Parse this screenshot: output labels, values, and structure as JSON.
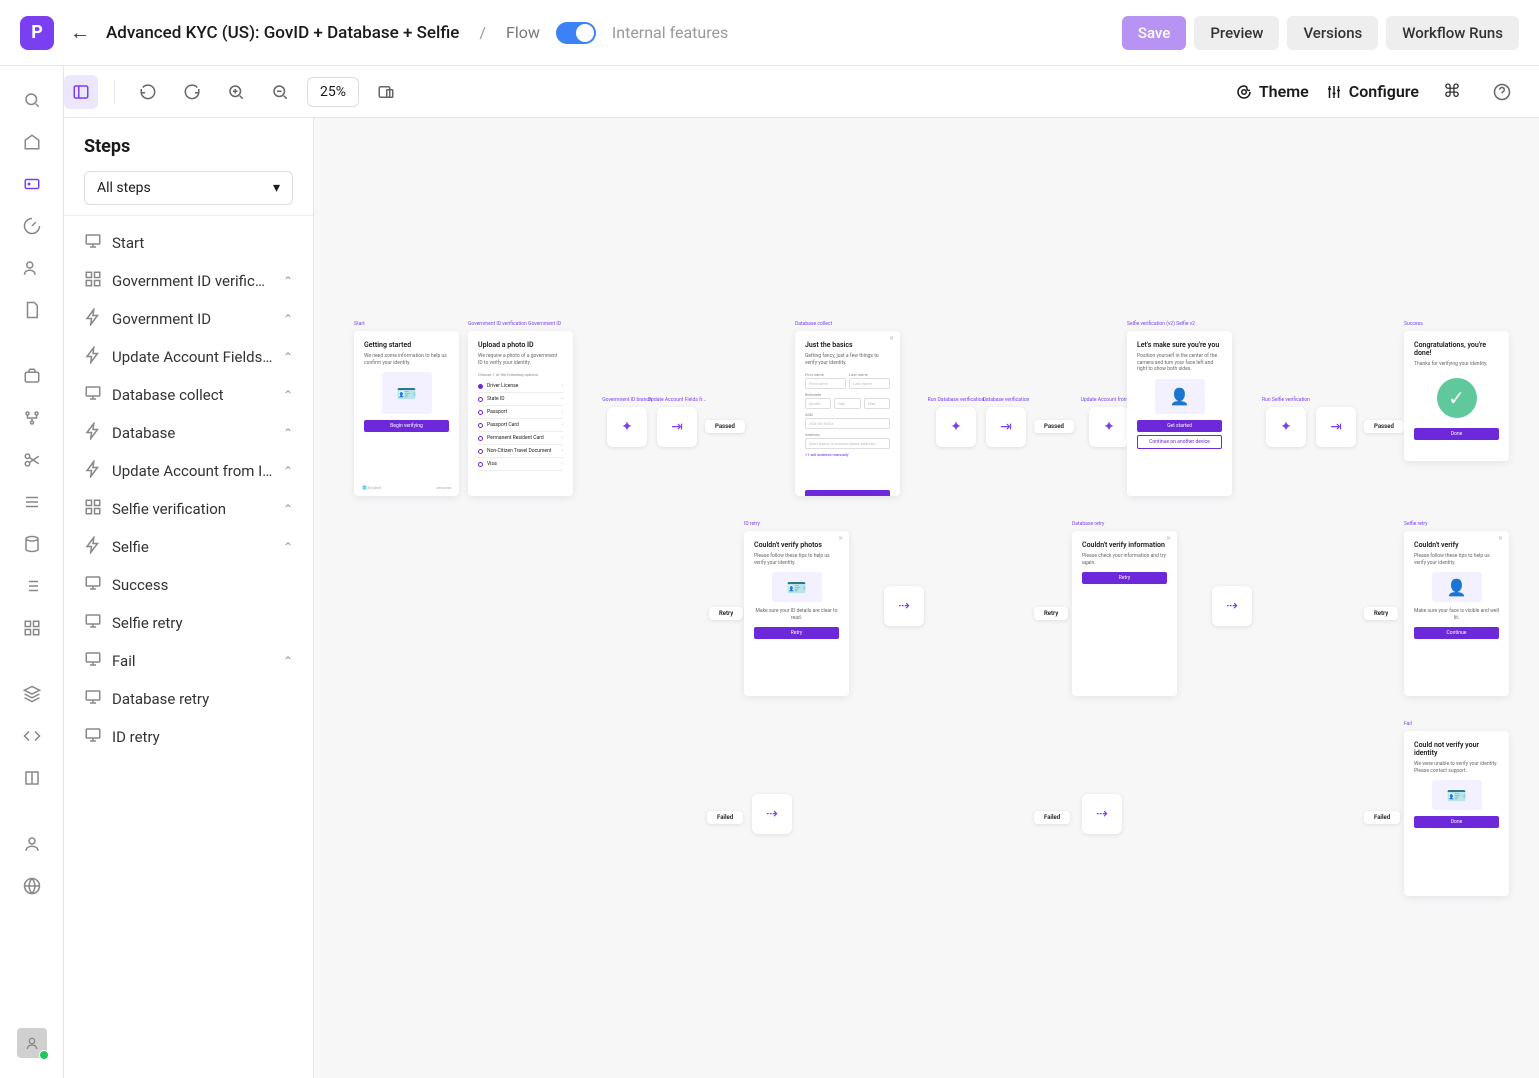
{
  "header": {
    "title": "Advanced KYC (US): GovID + Database + Selfie",
    "breadcrumb_slash": "/",
    "flow_label": "Flow",
    "internal_features": "Internal features",
    "save": "Save",
    "preview": "Preview",
    "versions": "Versions",
    "workflow_runs": "Workflow Runs"
  },
  "toolbar": {
    "zoom": "25%",
    "theme": "Theme",
    "configure": "Configure"
  },
  "sidebar": {
    "title": "Steps",
    "filter": "All steps",
    "items": [
      {
        "icon": "monitor",
        "label": "Start",
        "chev": false
      },
      {
        "icon": "grid",
        "label": "Government ID verificati…",
        "chev": true
      },
      {
        "icon": "bolt",
        "label": "Government ID",
        "chev": true
      },
      {
        "icon": "bolt",
        "label": "Update Account Fields fr…",
        "chev": true
      },
      {
        "icon": "monitor",
        "label": "Database collect",
        "chev": true
      },
      {
        "icon": "bolt",
        "label": "Database",
        "chev": true
      },
      {
        "icon": "bolt",
        "label": "Update Account from In…",
        "chev": true
      },
      {
        "icon": "grid",
        "label": "Selfie verification",
        "chev": true
      },
      {
        "icon": "bolt",
        "label": "Selfie",
        "chev": true
      },
      {
        "icon": "monitor",
        "label": "Success",
        "chev": false
      },
      {
        "icon": "monitor",
        "label": "Selfie retry",
        "chev": false
      },
      {
        "icon": "monitor",
        "label": "Fail",
        "chev": true
      },
      {
        "icon": "monitor",
        "label": "Database retry",
        "chev": false
      },
      {
        "icon": "monitor",
        "label": "ID retry",
        "chev": false
      }
    ]
  },
  "screens": {
    "start": {
      "label": "Start",
      "title": "Getting started",
      "desc": "We need some information to help us confirm your identity.",
      "btn": "Begin verifying",
      "footer_lang": "English",
      "footer_brand": "persona"
    },
    "upload": {
      "label": "Government ID verification   Government ID",
      "title": "Upload a photo ID",
      "desc": "We require a photo of a government ID to verify your identity.",
      "choose": "Choose 1 of the following options",
      "options": [
        "Driver License",
        "State ID",
        "Passport",
        "Passport Card",
        "Permanent Resident Card",
        "Non-Citizen Travel Document",
        "Visa"
      ]
    },
    "basics": {
      "label": "Database collect",
      "title": "Just the basics",
      "desc": "Getting fancy, just a few things to verify your identity.",
      "first": "First name",
      "last": "Last name",
      "birth": "Birthdate",
      "month": "Month",
      "day": "Day",
      "year": "Year",
      "ssn": "SSN",
      "ssn_ph": "XXX-XX-XXXX",
      "address": "Address",
      "addr_ph": "Start typing to autocomplete address...",
      "manual": "+ I will address manually"
    },
    "selfie": {
      "label": "Selfie verification (v2)   Selfie v2",
      "title": "Let's make sure you're you",
      "desc": "Position yourself in the center of the camera and turn your face left and right to show both sides.",
      "btn": "Get started",
      "btn2": "Continue on another device"
    },
    "success": {
      "label": "Success",
      "title": "Congratulations, you're done!",
      "desc": "Thanks for verifying your identity.",
      "btn": "Done"
    },
    "retry_photo": {
      "label": "ID retry",
      "title": "Couldn't verify photos",
      "desc": "Please follow these tips to help us verify your identity.",
      "tip": "Make sure your ID details are clear to read.",
      "btn": "Retry"
    },
    "retry_info": {
      "label": "Database retry",
      "title": "Couldn't verify information",
      "desc": "Please check your information and try again.",
      "btn": "Retry"
    },
    "retry_selfie": {
      "label": "Selfie retry",
      "title": "Couldn't verify",
      "desc": "Please follow these tips to help us verify your identity.",
      "tip": "Make sure your face is visible and well lit.",
      "btn": "Continue"
    },
    "fail": {
      "label": "Fail",
      "title": "Could not verify your identity",
      "desc": "We were unable to verify your identity. Please contact support.",
      "btn": "Done"
    }
  },
  "status": {
    "passed": "Passed",
    "retry": "Retry",
    "failed": "Failed"
  },
  "nodes": {
    "gov_id_branch": "Government ID branch",
    "update_fields": "Update Account Fields fr...",
    "db_branch": "Run Database verification",
    "db_verif": "Database verification",
    "update_acct": "Update Account from In...",
    "selfie_verif": "Run Selfie verification"
  }
}
